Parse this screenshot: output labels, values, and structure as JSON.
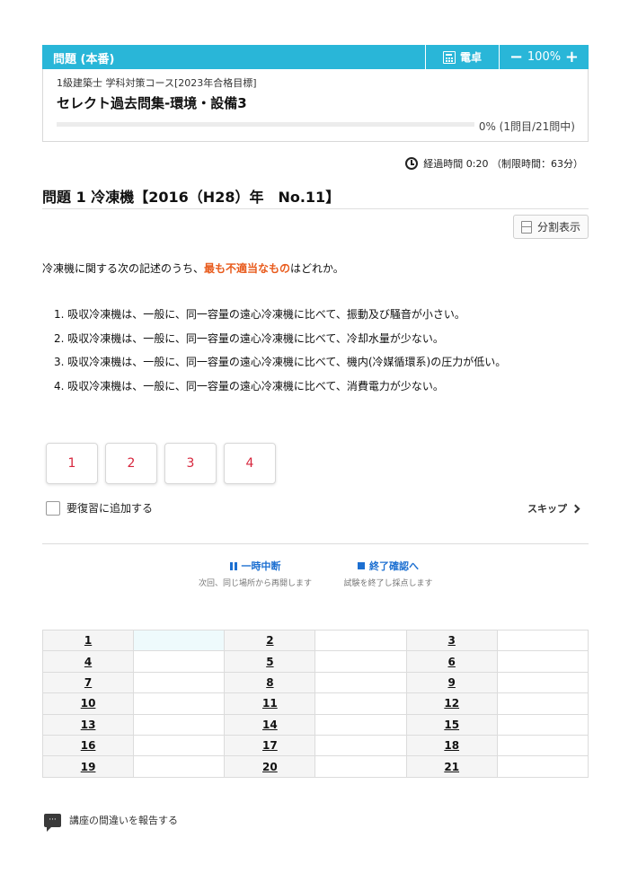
{
  "header": {
    "title": "問題 (本番)",
    "calculator_label": "電卓",
    "zoom_minus": "−",
    "zoom_level": "100%",
    "zoom_plus": "+",
    "course_name": "1級建築士 学科対策コース[2023年合格目標]",
    "set_title": "セレクト過去問集-環境・設備3",
    "progress_fraction": 0,
    "progress_text": "0% (1問目/21問中)"
  },
  "timer": {
    "text": "経過時間 0:20 （制限時間：63分）"
  },
  "question": {
    "heading": "問題 1 冷凍機【2016（H28）年　No.11】",
    "split_label": "分割表示",
    "prompt_before": "冷凍機に関する次の記述のうち、",
    "prompt_emphasis": "最も不適当なもの",
    "prompt_after": "はどれか。",
    "choices": [
      "1. 吸収冷凍機は、一般に、同一容量の遠心冷凍機に比べて、振動及び騒音が小さい。",
      "2. 吸収冷凍機は、一般に、同一容量の遠心冷凍機に比べて、冷却水量が少ない。",
      "3. 吸収冷凍機は、一般に、同一容量の遠心冷凍機に比べて、機内(冷媒循環系)の圧力が低い。",
      "4. 吸収冷凍機は、一般に、同一容量の遠心冷凍機に比べて、消費電力が少ない。"
    ]
  },
  "answers": [
    "1",
    "2",
    "3",
    "4"
  ],
  "review_label": "要復習に追加する",
  "skip_label": "スキップ",
  "actions": {
    "pause_label": "一時中断",
    "pause_sub": "次回、同じ場所から再開します",
    "finish_label": "終了確認へ",
    "finish_sub": "試験を終了し採点します"
  },
  "grid": {
    "rows": [
      [
        "1",
        "2",
        "3"
      ],
      [
        "4",
        "5",
        "6"
      ],
      [
        "7",
        "8",
        "9"
      ],
      [
        "10",
        "11",
        "12"
      ],
      [
        "13",
        "14",
        "15"
      ],
      [
        "16",
        "17",
        "18"
      ],
      [
        "19",
        "20",
        "21"
      ]
    ]
  },
  "report_label": "講座の間違いを報告する",
  "colors": {
    "accent": "#29b6d8",
    "emphasis": "#e85a1b",
    "answer_text": "#d7263d",
    "link": "#1c6fd1"
  }
}
